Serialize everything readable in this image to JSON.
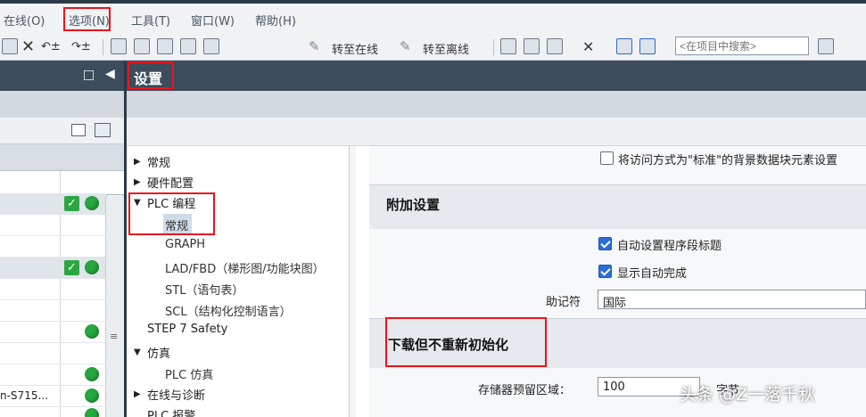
{
  "menubar": {
    "items": [
      "在线(O)",
      "选项(N)",
      "工具(T)",
      "窗口(W)",
      "帮助(H)"
    ]
  },
  "toolbar": {
    "go_online": "转至在线",
    "go_offline": "转至离线",
    "search_placeholder": "<在项目中搜索>"
  },
  "settings": {
    "title": "设置"
  },
  "nav_tree": {
    "general": "常规",
    "hardware_config": "硬件配置",
    "plc_programming": "PLC 编程",
    "plc_general": "常规",
    "graph": "GRAPH",
    "ladfbd": "LAD/FBD（梯形图/功能块图）",
    "stl": "STL（语句表）",
    "scl": "SCL（结构化控制语言）",
    "step7_safety": "STEP 7 Safety",
    "simulation": "仿真",
    "plc_sim": "PLC 仿真",
    "online_diag": "在线与诊断",
    "plc_alarm": "PLC 报警"
  },
  "left_panel": {
    "row_label": "n-S715..."
  },
  "content": {
    "std_access_label": "将访问方式为\"标准\"的背景数据块元素设置",
    "additional_settings": "附加设置",
    "auto_block_title": "自动设置程序段标题",
    "show_autocomplete": "显示自动完成",
    "mnemonic_label": "助记符",
    "mnemonic_value": "国际",
    "download_section": "下载但不重新初始化",
    "memory_reserve_label": "存储器预留区域：",
    "memory_reserve_value": "100",
    "memory_reserve_unit": "字节",
    "checkboxes": {
      "std_access": false,
      "auto_block_title": true,
      "show_autocomplete": true
    }
  },
  "watermark": "头条 @Z一落千秋"
}
